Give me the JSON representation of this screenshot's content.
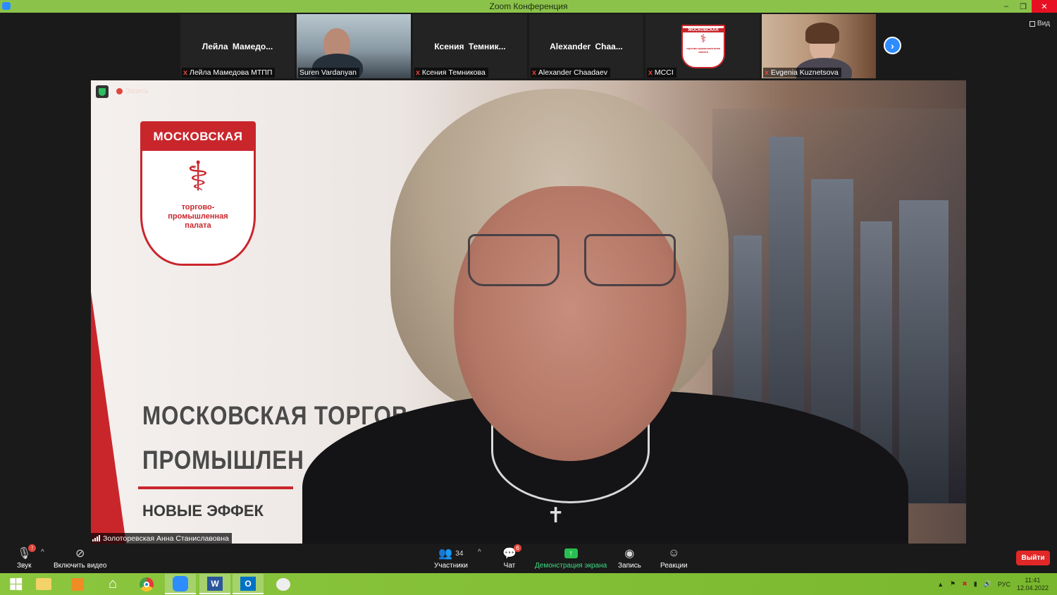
{
  "window": {
    "title": "Zoom Конференция",
    "minimize": "–",
    "maximize": "❐",
    "close": "✕"
  },
  "strip": {
    "view_label": "Вид",
    "participants": [
      {
        "center_name": "Лейла Мамедо...",
        "label": "Лейла Мамедова МТПП",
        "muted": true
      },
      {
        "center_name": "",
        "label": "Suren Vardanyan",
        "muted": false
      },
      {
        "center_name": "Ксения Темник...",
        "label": "Ксения Темникова",
        "muted": true
      },
      {
        "center_name": "Alexander Chaa...",
        "label": "Alexander Chaadaev",
        "muted": true
      },
      {
        "center_name": "",
        "label": "MCCI",
        "muted": true
      },
      {
        "center_name": "",
        "label": "Evgenia Kuznetsova",
        "muted": true
      }
    ],
    "mcci_logo": {
      "bar": "МОСКОВСКАЯ",
      "symbol": "⚕",
      "text": "торгово-промышленная палата"
    },
    "next_icon": "›"
  },
  "main": {
    "recording_label": "Запись",
    "speaker_name": "Золоторевская Анна Станиславовна",
    "slide": {
      "logo_bar": "МОСКОВСКАЯ",
      "logo_symbol": "⚕",
      "logo_text": "торгово-\nпромышленная\nпалата",
      "title_line1": "МОСКОВСКАЯ ТОРГОВ",
      "title_line2": "ПРОМЫШЛЕН",
      "subtitle": "НОВЫЕ ЭФФЕК"
    }
  },
  "controls": {
    "audio": "Звук",
    "video": "Включить видео",
    "participants": "Участники",
    "participants_count": "34",
    "chat": "Чат",
    "chat_badge": "6",
    "share": "Демонстрация экрана",
    "record": "Запись",
    "reactions": "Реакции",
    "leave": "Выйти",
    "audio_badge": "!"
  },
  "taskbar": {
    "lang": "РУС",
    "time": "11:41",
    "date": "12.04.2022"
  },
  "colors": {
    "zoom_green": "#8bc34a",
    "accent_blue": "#2d8cff",
    "leave_red": "#e02828",
    "brand_red": "#c9262c"
  }
}
